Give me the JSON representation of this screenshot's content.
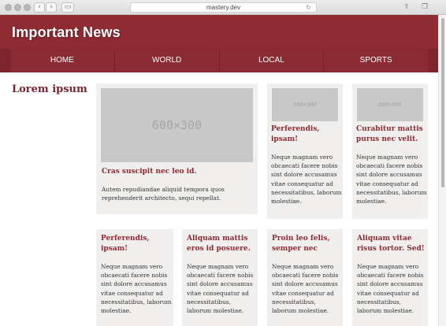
{
  "browser": {
    "url": "mastery.dev",
    "back_glyph": "‹",
    "forward_glyph": "›",
    "sidebar_glyph": "▭",
    "reload_glyph": "↻",
    "share_glyph": "⇧",
    "tabs_glyph": "❐"
  },
  "header": {
    "title": "Important News"
  },
  "nav": {
    "items": [
      "HOME",
      "WORLD",
      "LOCAL",
      "SPORTS"
    ]
  },
  "sidebar": {
    "heading": "Lorem ipsum"
  },
  "cards": [
    {
      "placeholder": "600×300",
      "title": "Cras suscipit nec leo id.",
      "body": "Autem repudiandae aliquid tempora quos reprehenderit architecto, sequi repellat."
    },
    {
      "placeholder": "600×300",
      "title": "Perferendis, ipsam!",
      "body": "Neque magnam vero obcaecati facere nobis sint dolore accusamus vitae consequatur ad necessitatibus, laborum molestiae."
    },
    {
      "placeholder": "600×300",
      "title": "Curabitur mattis purus nec velit.",
      "body": "Neque magnam vero obcaecati facere nobis sint dolore accusamus vitae consequatur ad necessitatibus, laborum molestiae."
    },
    {
      "title": "Perferendis, ipsam!",
      "body": "Neque magnam vero obcaecati facere nobis sint dolore accusamus vitae consequatur ad necessitatibus, laborum molestiae."
    },
    {
      "title": "Aliquam mattis eros id posuere.",
      "body": "Neque magnam vero obcaecati facere nobis sint dolore accusamus vitae consequatur ad necessitatibus, laborum molestiae."
    },
    {
      "title": "Proin leo felis, semper nec",
      "body": "Neque magnam vero obcaecati facere nobis sint dolore accusamus vitae consequatur ad necessitatibus, laborum molestiae."
    },
    {
      "title": "Aliquam vitae risus tortor. Sed!",
      "body": "Neque magnam vero obcaecati facere nobis sint dolore accusamus vitae consequatur ad necessitatibus, laborum molestiae."
    }
  ],
  "colors": {
    "brand": "#8f2c33",
    "nav": "#7e242c",
    "card_bg": "#f0efee",
    "placeholder": "#c8c8c8"
  }
}
